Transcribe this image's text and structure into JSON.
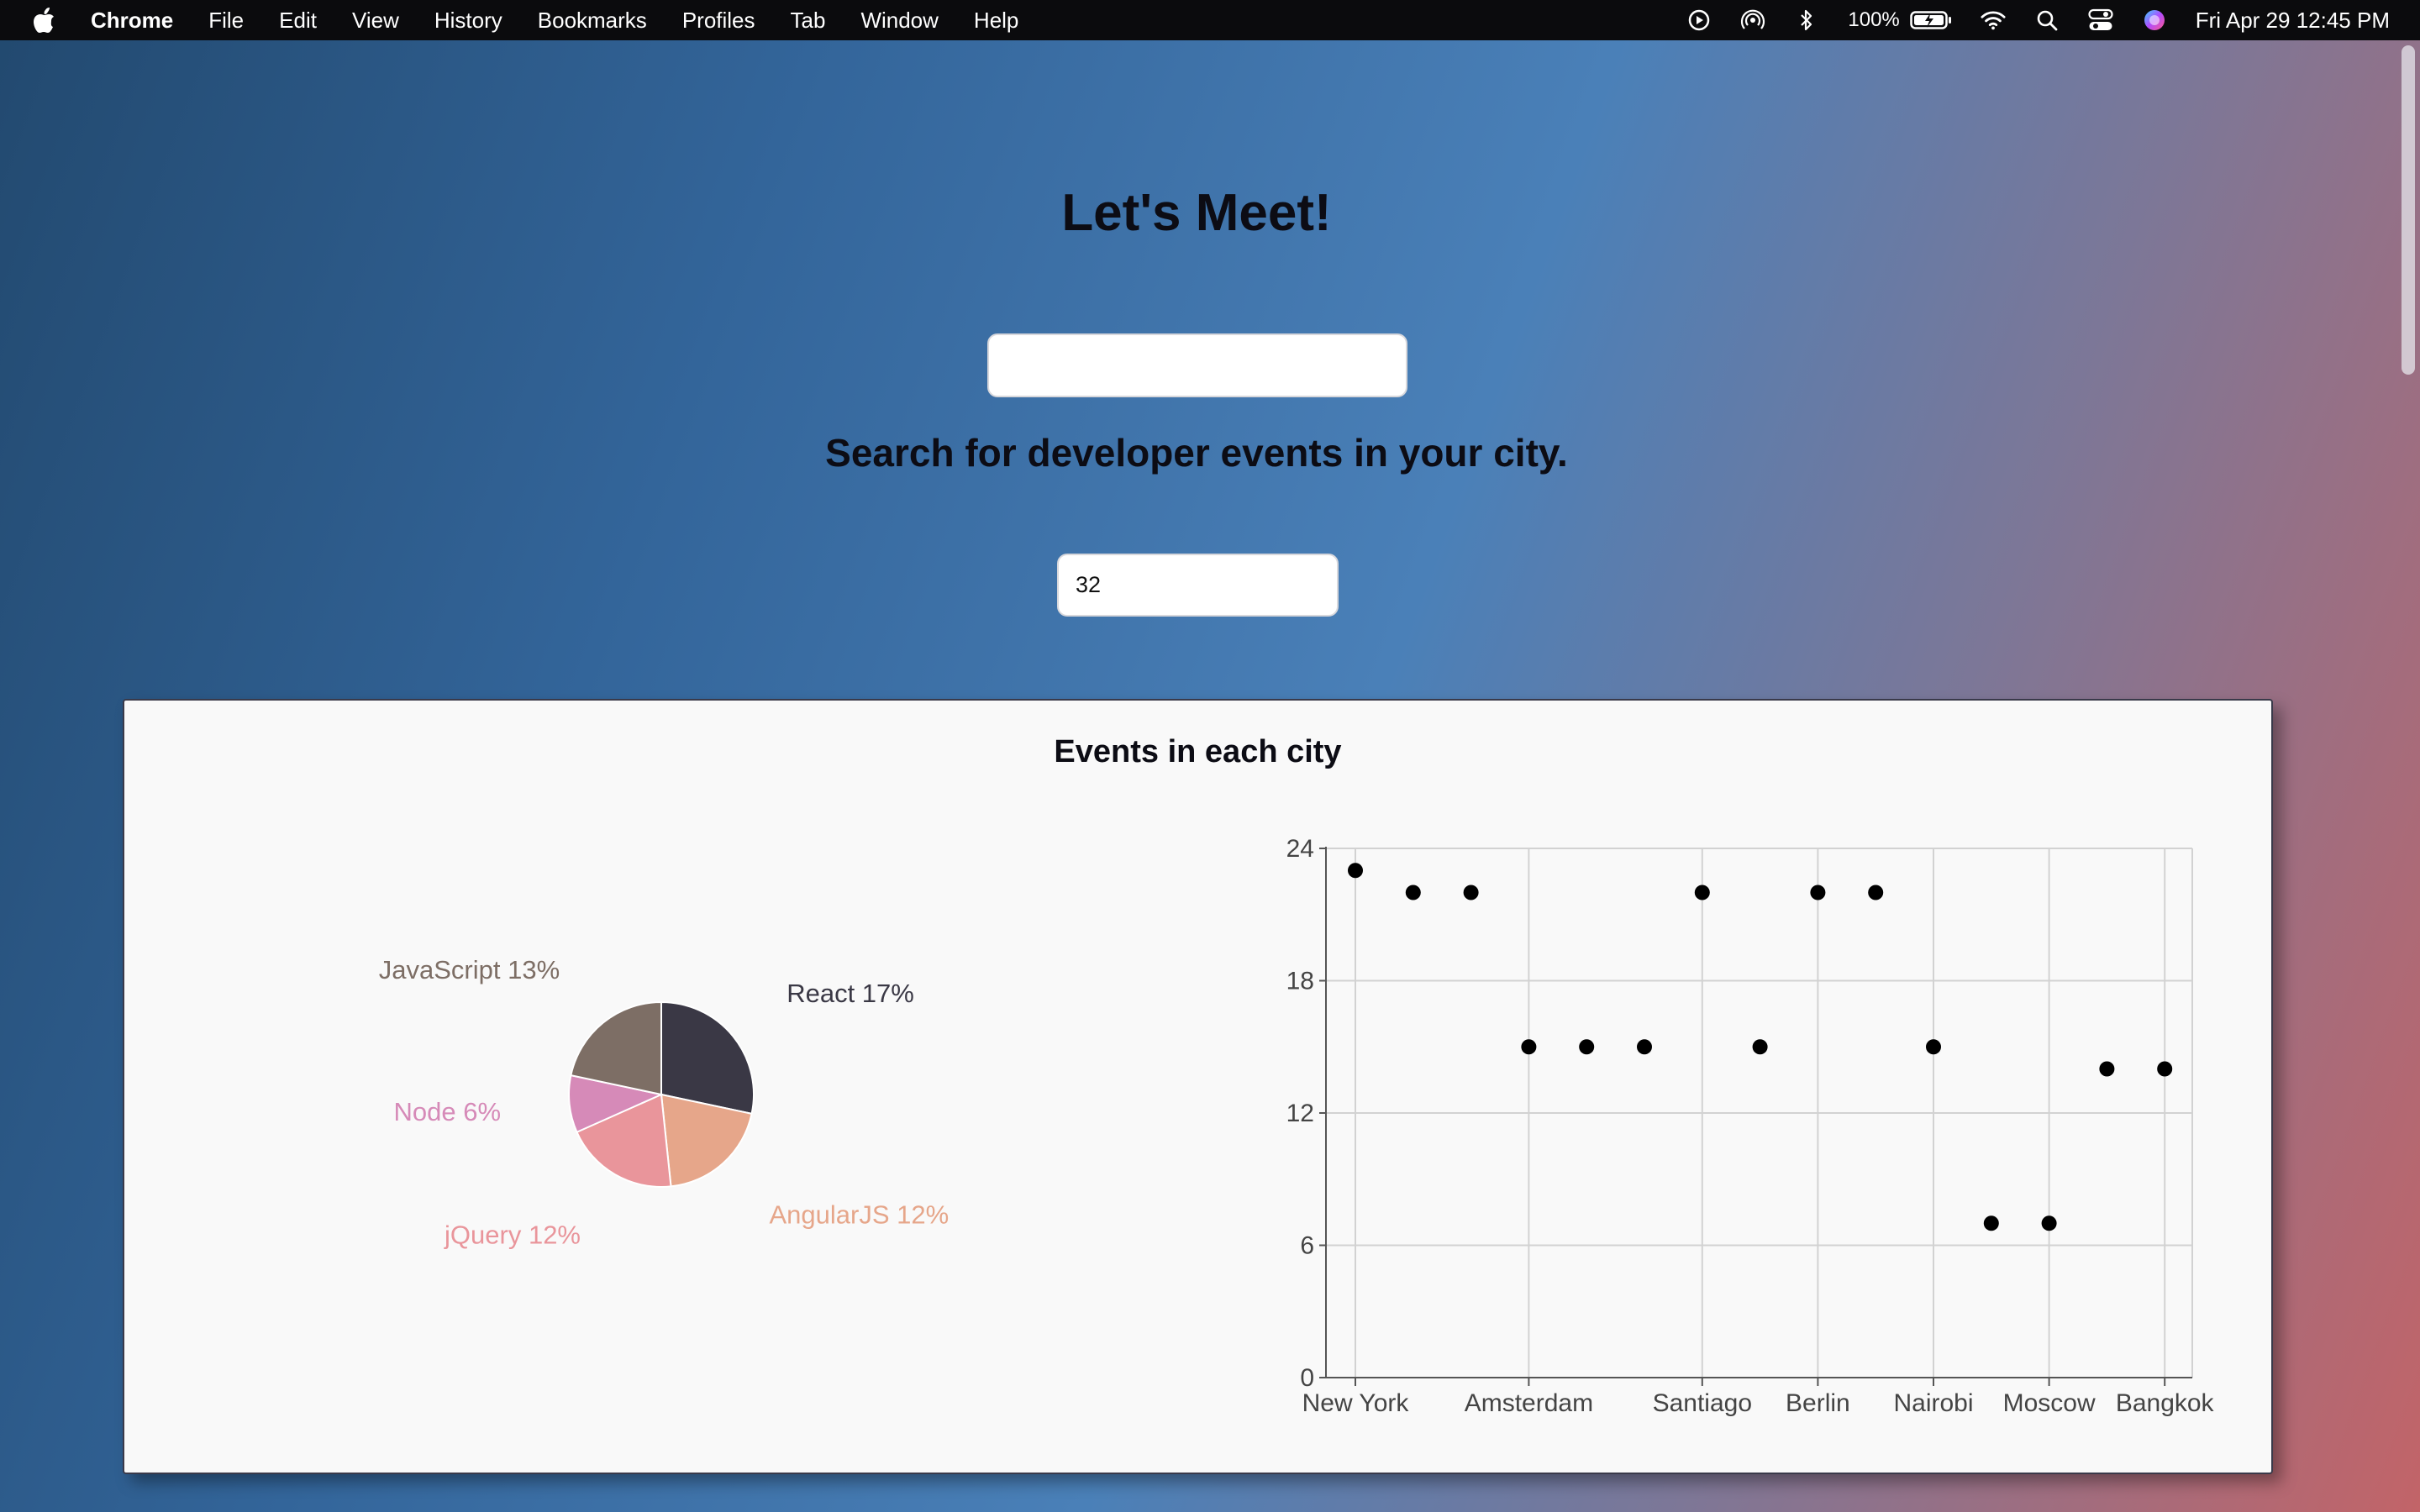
{
  "menubar": {
    "app_name": "Chrome",
    "items": [
      "File",
      "Edit",
      "View",
      "History",
      "Bookmarks",
      "Profiles",
      "Tab",
      "Window",
      "Help"
    ],
    "battery": "100%",
    "clock": "Fri Apr 29  12:45 PM",
    "icons": [
      "apple-icon",
      "play-icon",
      "airdrop-icon",
      "bluetooth-icon",
      "battery-icon",
      "wifi-icon",
      "search-icon",
      "control-center-icon",
      "siri-icon"
    ]
  },
  "page": {
    "title": "Let's Meet!",
    "city_search": {
      "value": "",
      "placeholder": ""
    },
    "subtitle": "Search for developer events in your city.",
    "number_of_events": {
      "value": "32"
    }
  },
  "charts": {
    "card_title": "Events in each city"
  },
  "chart_data": [
    {
      "type": "pie",
      "title": "",
      "slices": [
        {
          "label": "React 17%",
          "name": "React",
          "value": 17,
          "color": "#3a3845"
        },
        {
          "label": "AngularJS 12%",
          "name": "AngularJS",
          "value": 12,
          "color": "#e6a68a"
        },
        {
          "label": "jQuery 12%",
          "name": "jQuery",
          "value": 12,
          "color": "#e9959b"
        },
        {
          "label": "Node 6%",
          "name": "Node",
          "value": 6,
          "color": "#d68ab8"
        },
        {
          "label": "JavaScript 13%",
          "name": "JavaScript",
          "value": 13,
          "color": "#7d6e65"
        }
      ]
    },
    {
      "type": "scatter",
      "title": "",
      "xlabel": "",
      "ylabel": "",
      "x_tick_labels": [
        "New York",
        "Amsterdam",
        "Santiago",
        "Berlin",
        "Nairobi",
        "Moscow",
        "Bangkok"
      ],
      "y_ticks": [
        0,
        6,
        12,
        18,
        24
      ],
      "ylim": [
        0,
        24
      ],
      "grid": true,
      "point_color": "#000000",
      "y_values": [
        23,
        22,
        22,
        15,
        15,
        15,
        22,
        15,
        22,
        22,
        15,
        7,
        7,
        14,
        14
      ]
    }
  ]
}
